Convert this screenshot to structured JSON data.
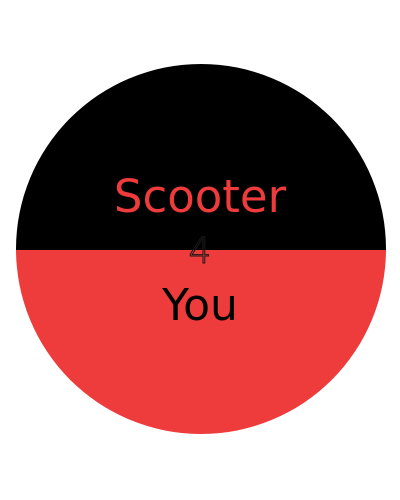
{
  "logo": {
    "line1": "Scooter",
    "line2": "4",
    "line3": "You"
  },
  "colors": {
    "black": "#000000",
    "red": "#ee3b3b",
    "background": "#ffffff"
  }
}
